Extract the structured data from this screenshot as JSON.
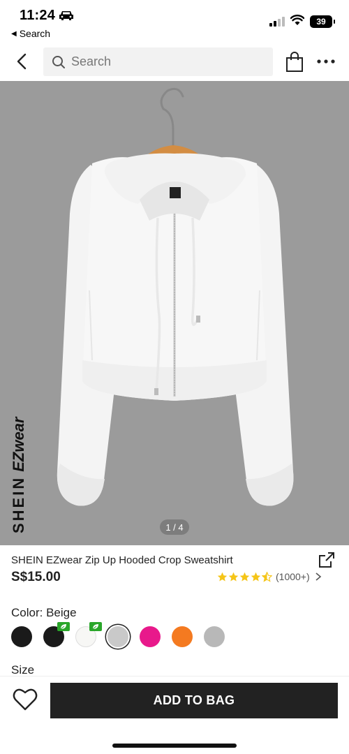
{
  "status_bar": {
    "time": "11:24",
    "back_app_label": "Search",
    "battery": "39",
    "icons": [
      "car-icon",
      "signal-icon",
      "wifi-icon",
      "battery-icon"
    ]
  },
  "nav": {
    "search_placeholder": "Search",
    "icons": [
      "back-arrow-icon",
      "search-icon",
      "shopping-bag-icon",
      "more-dots-icon"
    ]
  },
  "gallery": {
    "brand_primary": "SHEIN",
    "brand_secondary": "EZwear",
    "page_indicator": "1 / 4",
    "background_color": "#9b9b9b"
  },
  "product": {
    "title": "SHEIN EZwear Zip Up Hooded Crop Sweatshirt",
    "price": "S$15.00",
    "rating_stars": 4.5,
    "rating_count": "(1000+)",
    "star_color": "#f5c518"
  },
  "color": {
    "label": "Color: Beige",
    "swatches": [
      {
        "color": "#1a1a1a",
        "selected": false,
        "eco": false
      },
      {
        "color": "#1a1a1a",
        "selected": false,
        "eco": true
      },
      {
        "color": "#f7f7f5",
        "selected": false,
        "eco": true
      },
      {
        "color": "#c9c9c9",
        "selected": true,
        "eco": false
      },
      {
        "color": "#e8198b",
        "selected": false,
        "eco": false
      },
      {
        "color": "#f47a20",
        "selected": false,
        "eco": false
      },
      {
        "color": "#b8b8b8",
        "selected": false,
        "eco": false
      }
    ]
  },
  "size": {
    "label": "Size"
  },
  "bottom": {
    "add_to_bag_label": "ADD TO BAG"
  }
}
